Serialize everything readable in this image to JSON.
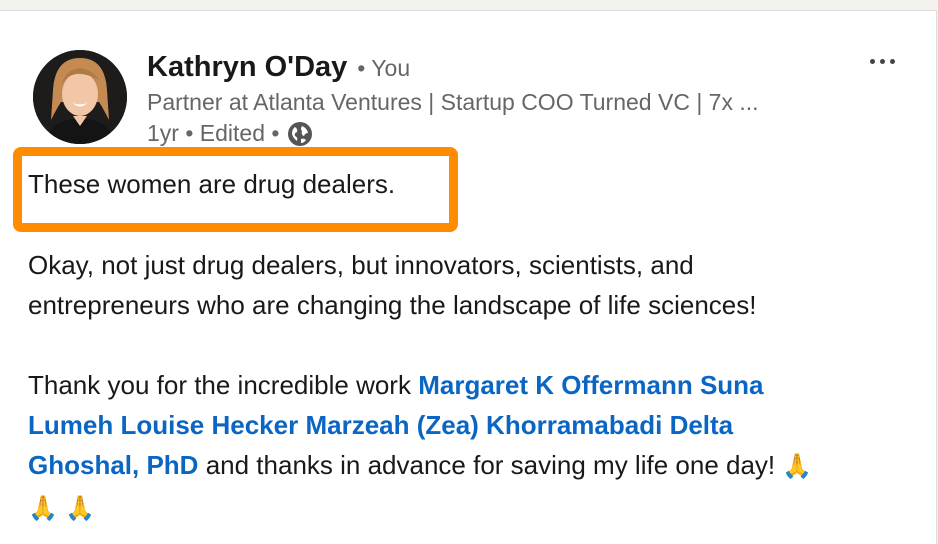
{
  "author": {
    "name": "Kathryn O'Day",
    "relation": "• You",
    "headline": "Partner at Atlanta Ventures | Startup COO Turned VC | 7x ...",
    "meta": "1yr • Edited •",
    "visibility_icon": "globe-icon"
  },
  "post": {
    "line1": "These women are drug dealers.",
    "para1_line1": "Okay, not just drug dealers, but innovators, scientists, and",
    "para1_line2": "entrepreneurs who are changing the landscape of life sciences!",
    "para2_intro": "Thank you for the incredible work ",
    "mention_1a": "Margaret K Offermann",
    "mention_2a": "Suna",
    "mention_2b": "Lumeh",
    "mention_3": "Louise Hecker",
    "mention_4": "Marzeah (Zea) Khorramabadi",
    "mention_5a": "Delta",
    "mention_5b": "Ghoshal, PhD",
    "para2_outro": " and thanks in advance for saving my life one day! ",
    "emoji": "🙏"
  },
  "colors": {
    "highlight": "#ff8c00",
    "mention": "#0a66c2"
  }
}
